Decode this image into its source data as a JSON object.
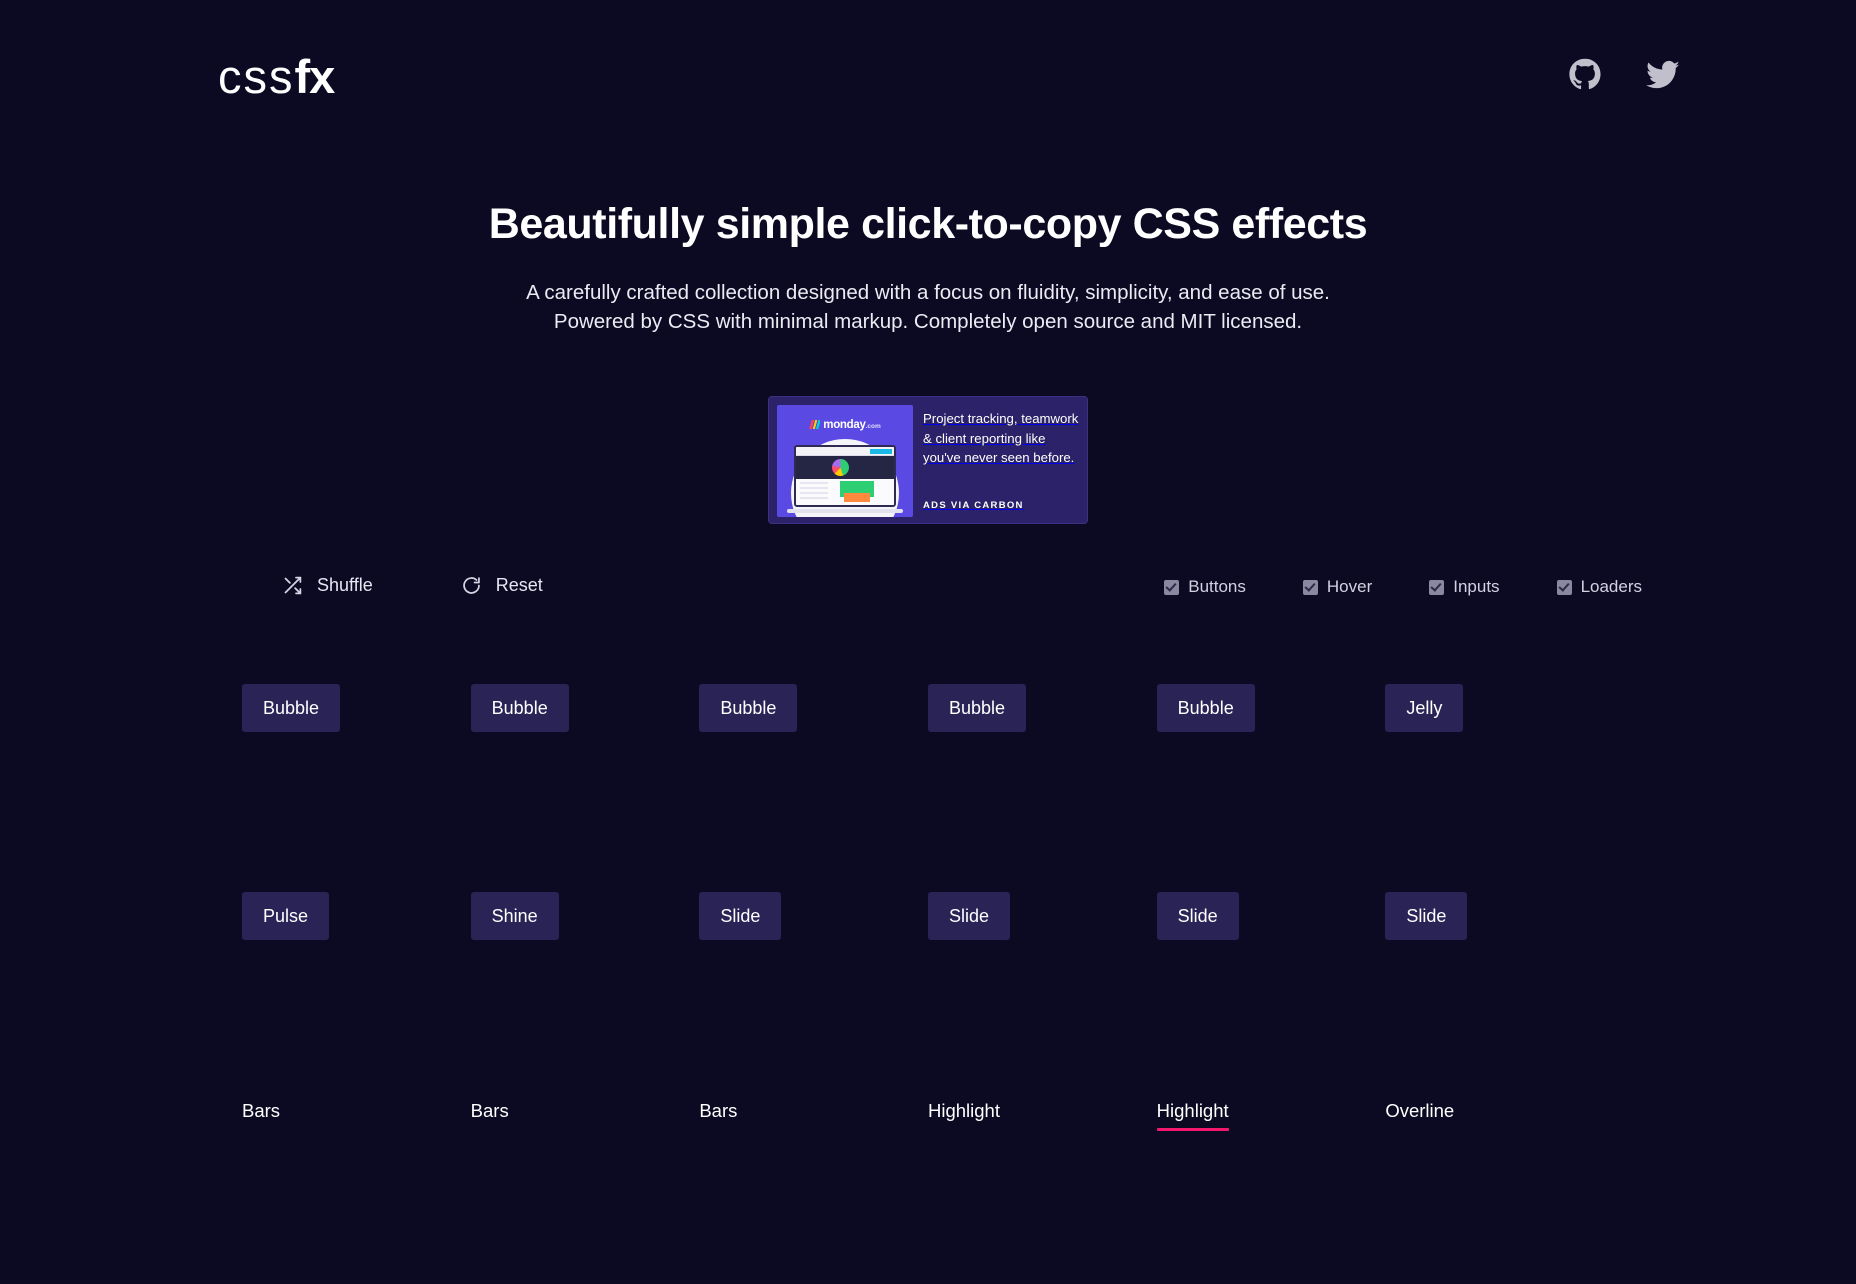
{
  "site": {
    "logo_thin": "css",
    "logo_bold": "fx",
    "gradient_start": "#18d7f5",
    "gradient_end": "#ff2d7a"
  },
  "header": {
    "social": [
      {
        "name": "github-icon",
        "label": "GitHub"
      },
      {
        "name": "twitter-icon",
        "label": "Twitter"
      }
    ]
  },
  "hero": {
    "title": "Beautifully simple click-to-copy CSS effects",
    "subtitle_line1": "A carefully crafted collection designed with a focus on fluidity, simplicity, and ease of use.",
    "subtitle_line2": "Powered by CSS with minimal markup. Completely open source and MIT licensed."
  },
  "ad": {
    "brand": "monday",
    "brand_suffix": ".com",
    "text": "Project tracking, teamwork & client reporting like you've never seen before.",
    "via": "ADS VIA CARBON",
    "background": "#2b2269",
    "thumb_background": "#5a4ae3"
  },
  "toolbar": {
    "shuffle_label": "Shuffle",
    "reset_label": "Reset",
    "filters": [
      {
        "label": "Buttons",
        "checked": true
      },
      {
        "label": "Hover",
        "checked": true
      },
      {
        "label": "Inputs",
        "checked": true
      },
      {
        "label": "Loaders",
        "checked": true
      }
    ]
  },
  "grid": {
    "button_fill": "#2a2356",
    "accent": "#f5176b",
    "items": [
      {
        "label": "Bubble",
        "kind": "button",
        "active": false
      },
      {
        "label": "Bubble",
        "kind": "button",
        "active": false
      },
      {
        "label": "Bubble",
        "kind": "button",
        "active": false
      },
      {
        "label": "Bubble",
        "kind": "button",
        "active": false
      },
      {
        "label": "Bubble",
        "kind": "button",
        "active": false
      },
      {
        "label": "Jelly",
        "kind": "button",
        "active": false
      },
      {
        "label": "Pulse",
        "kind": "button",
        "active": false
      },
      {
        "label": "Shine",
        "kind": "button",
        "active": false
      },
      {
        "label": "Slide",
        "kind": "button",
        "active": false
      },
      {
        "label": "Slide",
        "kind": "button",
        "active": false
      },
      {
        "label": "Slide",
        "kind": "button",
        "active": false
      },
      {
        "label": "Slide",
        "kind": "button",
        "active": false
      },
      {
        "label": "Bars",
        "kind": "link",
        "active": false
      },
      {
        "label": "Bars",
        "kind": "link",
        "active": false
      },
      {
        "label": "Bars",
        "kind": "link",
        "active": false
      },
      {
        "label": "Highlight",
        "kind": "link",
        "active": false
      },
      {
        "label": "Highlight",
        "kind": "link",
        "active": true
      },
      {
        "label": "Overline",
        "kind": "link",
        "active": false
      }
    ]
  }
}
